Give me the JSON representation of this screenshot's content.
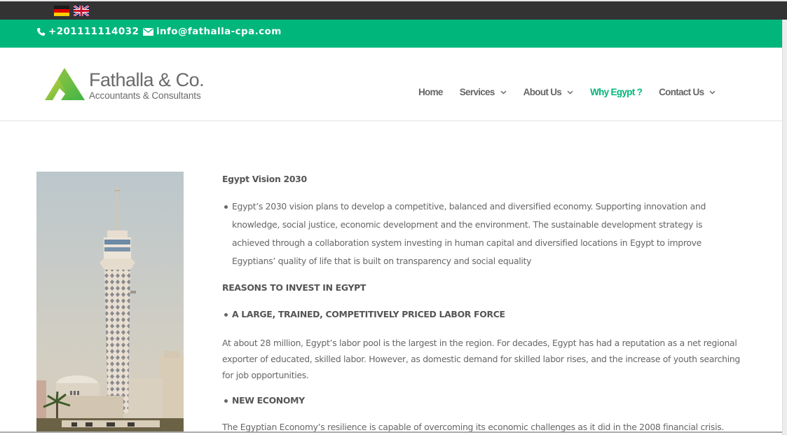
{
  "language_bar": {
    "flags": [
      {
        "name": "German",
        "icon": "flag-de-icon"
      },
      {
        "name": "English",
        "icon": "flag-uk-icon"
      }
    ]
  },
  "top_bar": {
    "phone": "+201111114032",
    "email": "info@fathalla-cpa.com",
    "background_color": "#00b67b"
  },
  "logo": {
    "title": "Fathalla & Co.",
    "subtitle": "Accountants & Consultants"
  },
  "nav": {
    "items": [
      {
        "label": "Home",
        "has_dropdown": false,
        "active": false
      },
      {
        "label": "Services",
        "has_dropdown": true,
        "active": false
      },
      {
        "label": "About Us",
        "has_dropdown": true,
        "active": false
      },
      {
        "label": "Why Egypt ?",
        "has_dropdown": false,
        "active": true
      },
      {
        "label": "Contact Us",
        "has_dropdown": true,
        "active": false
      }
    ],
    "active_color": "#00b67b"
  },
  "image": {
    "description": "Cairo Tower"
  },
  "content": {
    "vision_title": "Egypt Vision 2030",
    "vision_text": "Egypt’s 2030 vision plans to develop a competitive, balanced and diversified economy. Supporting innovation and knowledge, social justice, economic development and the environment. The sustainable development strategy is achieved through a collaboration system investing in human capital and diversified locations in Egypt to improve Egyptians’ quality of life that is built on transparency and social equality",
    "reasons_title": "REASONS TO INVEST IN EGYPT",
    "labor_heading": "A LARGE, TRAINED, COMPETITIVELY PRICED LABOR FORCE",
    "labor_text": "At about 28 million, Egypt’s labor pool is the largest in the region. For decades, Egypt has had a reputation as a net regional exporter of educated, skilled labor. However, as domestic demand for skilled labor rises, and the increase of youth searching for job opportunities.",
    "economy_heading": "NEW ECONOMY",
    "economy_text": "The Egyptian Economy’s resilience is capable of overcoming its economic challenges as it did in the 2008 financial crisis."
  }
}
